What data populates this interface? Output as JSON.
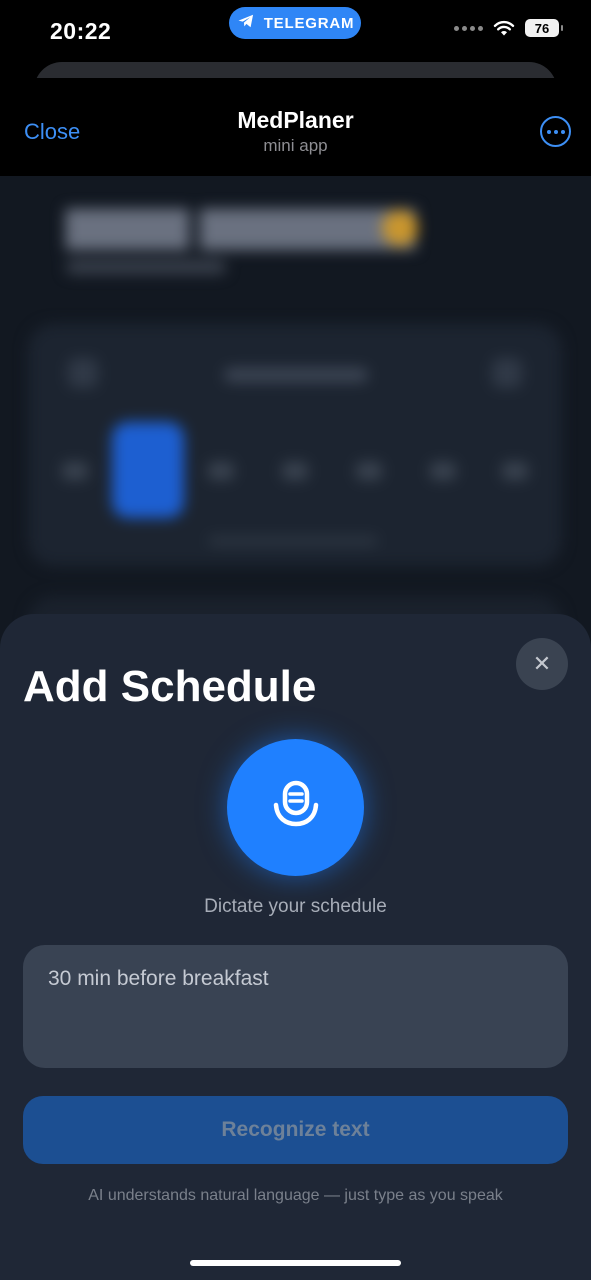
{
  "status_bar": {
    "time": "20:22",
    "source_pill": "TELEGRAM",
    "battery": "76",
    "icons": [
      "telegram-icon",
      "wifi-icon",
      "battery-icon"
    ]
  },
  "header": {
    "close_label": "Close",
    "title": "MedPlaner",
    "subtitle": "mini app",
    "more_icon": "more-icon"
  },
  "sheet": {
    "title": "Add Schedule",
    "close_icon": "close-icon",
    "mic_icon": "microphone-icon",
    "mic_caption": "Dictate your schedule",
    "input_value": "30 min before breakfast",
    "recognize_label": "Recognize text",
    "hint": "AI understands natural language — just type as you speak"
  },
  "colors": {
    "accent": "#1f80ff",
    "link": "#3d8ff5",
    "sheet_bg": "#1f2736",
    "input_bg": "#394353",
    "button_disabled": "#1c4f92"
  }
}
